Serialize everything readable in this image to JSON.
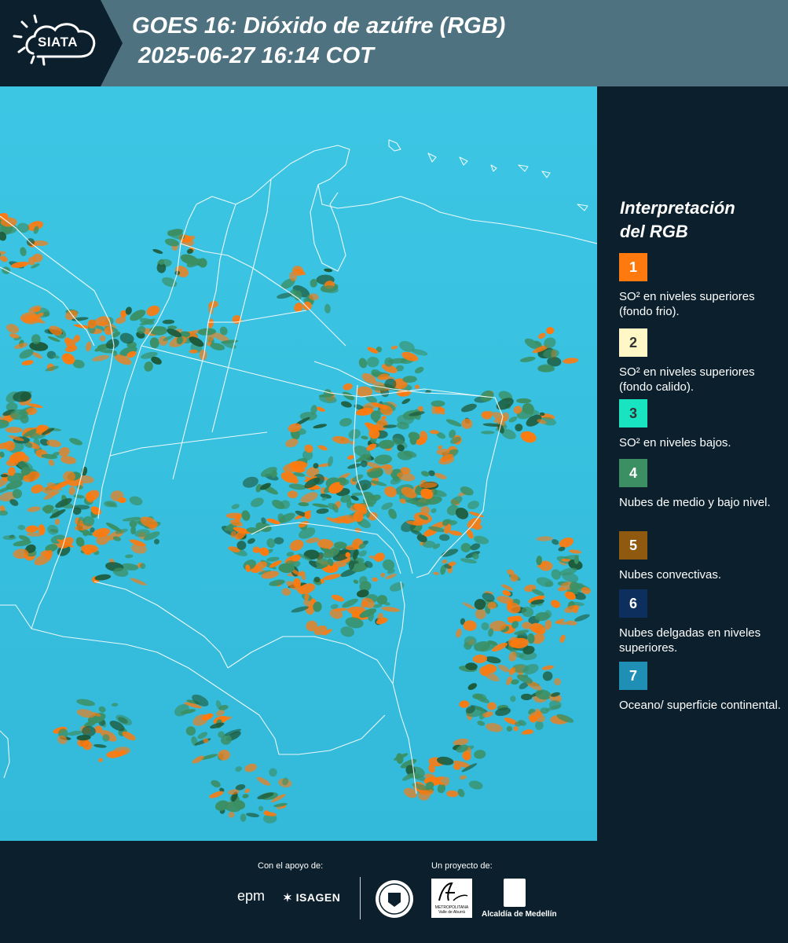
{
  "header": {
    "logo_text": "SIATA",
    "title_line1": "GOES 16: Dióxido de azúfre (RGB)",
    "title_line2": "2025-06-27 16:14 COT"
  },
  "legend": {
    "title_line1": "Interpretación",
    "title_line2": "del RGB",
    "items": [
      {
        "number": "1",
        "color": "#fe7a0e",
        "text": "SO² en niveles superiores (fondo frio)."
      },
      {
        "number": "2",
        "color": "#fff7c5",
        "text": "SO² en niveles superiores (fondo calido)."
      },
      {
        "number": "3",
        "color": "#18e4c2",
        "text": "SO² en niveles bajos."
      },
      {
        "number": "4",
        "color": "#3b8f63",
        "text": "Nubes de medio y bajo nivel."
      },
      {
        "number": "5",
        "color": "#8f5a10",
        "text": "Nubes convectivas."
      },
      {
        "number": "6",
        "color": "#0d2f5e",
        "text": "Nubes delgadas en niveles superiores."
      },
      {
        "number": "7",
        "color": "#1f8fb5",
        "text": "Oceano/ superficie continental."
      }
    ]
  },
  "footer": {
    "support_label": "Con el apoyo de:",
    "project_label": "Un proyecto de:",
    "sponsors": [
      "epm",
      "ISAGEN"
    ],
    "partners": [
      "METROPOLITANA Valle de Aburrá",
      "Alcaldía de Medellín"
    ]
  },
  "map": {
    "background_color": "#39bede",
    "cloud_colors": [
      "#fe7a0e",
      "#3b8f63",
      "#1d5a3a"
    ]
  }
}
